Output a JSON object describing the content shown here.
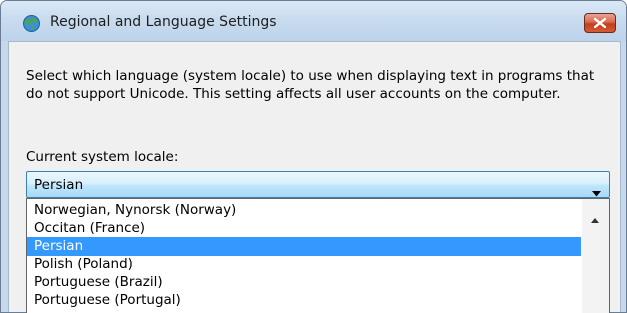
{
  "window": {
    "title": "Regional and Language Settings",
    "title_icon": "globe-icon",
    "close_icon": "close-icon"
  },
  "dialog": {
    "description": "Select which language (system locale) to use when displaying text in programs that do not support Unicode. This setting affects all user accounts on the computer.",
    "locale_label": "Current system locale:",
    "selected_locale": "Persian"
  },
  "locale_list": {
    "items": [
      {
        "label": "Norwegian, Nynorsk (Norway)",
        "selected": false
      },
      {
        "label": "Occitan (France)",
        "selected": false
      },
      {
        "label": "Persian",
        "selected": true
      },
      {
        "label": "Polish (Poland)",
        "selected": false
      },
      {
        "label": "Portuguese (Brazil)",
        "selected": false
      },
      {
        "label": "Portuguese (Portugal)",
        "selected": false
      }
    ]
  },
  "colors": {
    "selection": "#3399ff",
    "close_button": "#c0401e"
  }
}
